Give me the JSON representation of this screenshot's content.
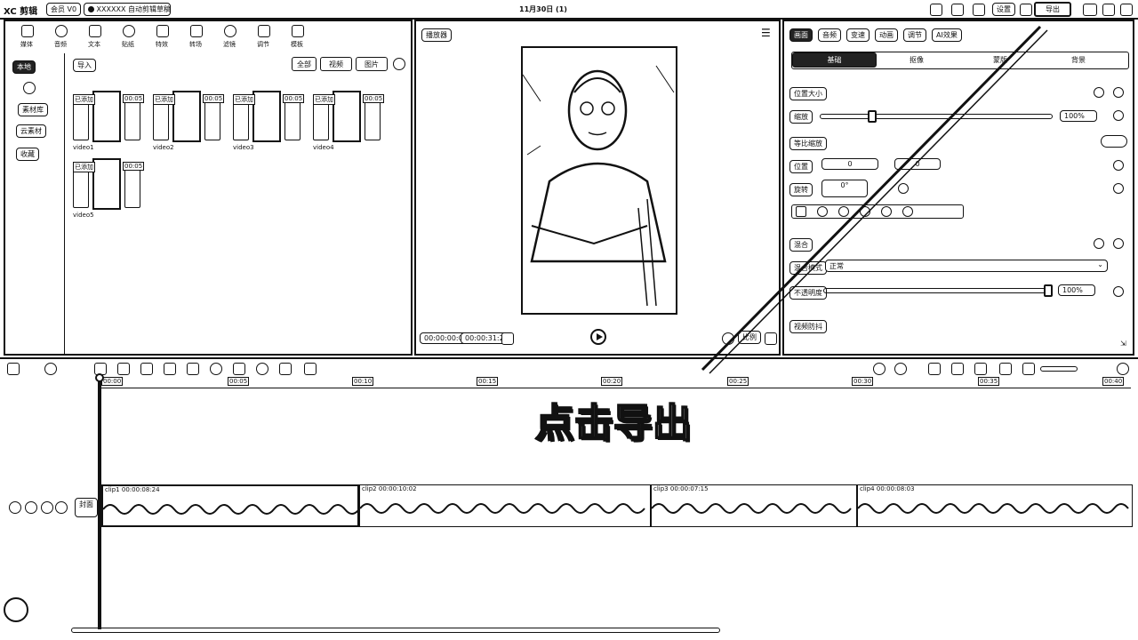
{
  "titlebar": {
    "logo": "XC 剪辑",
    "badge": "会员 V0",
    "project_name": "XXXXXX 自动剪辑草稿",
    "date_title": "11月30日 (1)",
    "export_button": "导出",
    "badges_right": [
      "设置"
    ]
  },
  "media_toolbar": {
    "tools": [
      {
        "icon": "media-icon",
        "label": "媒体"
      },
      {
        "icon": "audio-icon",
        "label": "音频"
      },
      {
        "icon": "text-icon",
        "label": "文本"
      },
      {
        "icon": "sticker-icon",
        "label": "贴纸"
      },
      {
        "icon": "effects-icon",
        "label": "特效"
      },
      {
        "icon": "transition-icon",
        "label": "转场"
      },
      {
        "icon": "filter-icon",
        "label": "滤镜"
      },
      {
        "icon": "adjust-icon",
        "label": "调节"
      },
      {
        "icon": "template-icon",
        "label": "模板"
      }
    ]
  },
  "media_sidebar": {
    "items": [
      "本地",
      "导入",
      "素材库",
      "云素材",
      "收藏"
    ]
  },
  "media_panel": {
    "import_label": "导入",
    "filter_buttons": [
      "全部",
      "视频",
      "图片"
    ],
    "thumbs": [
      {
        "tag_l": "已添加",
        "tag_r": "00:05",
        "caption": "video1"
      },
      {
        "tag_l": "已添加",
        "tag_r": "00:05",
        "caption": "video2"
      },
      {
        "tag_l": "已添加",
        "tag_r": "00:05",
        "caption": "video3"
      },
      {
        "tag_l": "已添加",
        "tag_r": "00:05",
        "caption": "video4"
      },
      {
        "tag_l": "已添加",
        "tag_r": "00:05",
        "caption": "video5"
      }
    ]
  },
  "player": {
    "title": "播放器",
    "current_time": "00:00:00:00",
    "total_time": "00:00:31:25",
    "ratio_label": "比例"
  },
  "properties": {
    "tabs": [
      "画面",
      "音频",
      "变速",
      "动画",
      "调节",
      "AI效果"
    ],
    "subtabs": [
      "基础",
      "抠像",
      "蒙版",
      "背景"
    ],
    "section_position": "位置大小",
    "scale_label": "缩放",
    "scale_value": "100%",
    "uniform_label": "等比缩放",
    "pos_label": "位置",
    "pos_x": "0",
    "pos_y": "0",
    "rotate_label": "旋转",
    "rotate_value": "0°",
    "mix_section": "混合",
    "mix_mode_label": "混合模式",
    "mix_mode_value": "正常",
    "opacity_label": "不透明度",
    "opacity_value": "100%",
    "anti_shake_label": "视频防抖"
  },
  "timeline": {
    "ruler_labels": [
      "00:00",
      "00:05",
      "00:10",
      "00:15",
      "00:20",
      "00:25",
      "00:30",
      "00:35",
      "00:40"
    ],
    "track_label": "封面",
    "clips": [
      {
        "title": "clip1 00:00:08:24"
      },
      {
        "title": "clip2 00:00:10:02"
      },
      {
        "title": "clip3 00:00:07:15"
      },
      {
        "title": "clip4 00:00:08:03"
      }
    ]
  },
  "overlay": {
    "caption": "点击导出"
  }
}
